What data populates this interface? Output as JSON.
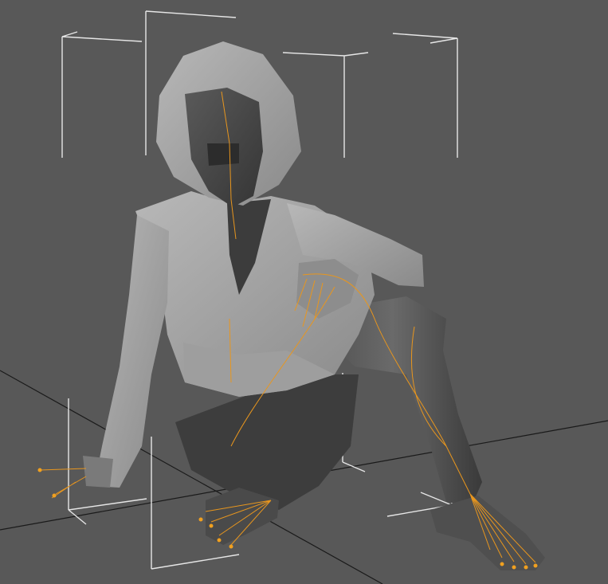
{
  "viewport": {
    "background": "#585858",
    "grid_color": "#1a1a1a",
    "selection_color": "#e6e6e6",
    "bone_color": "#e8961e",
    "mesh_light": "#a9a9a9",
    "mesh_dark": "#474747"
  }
}
